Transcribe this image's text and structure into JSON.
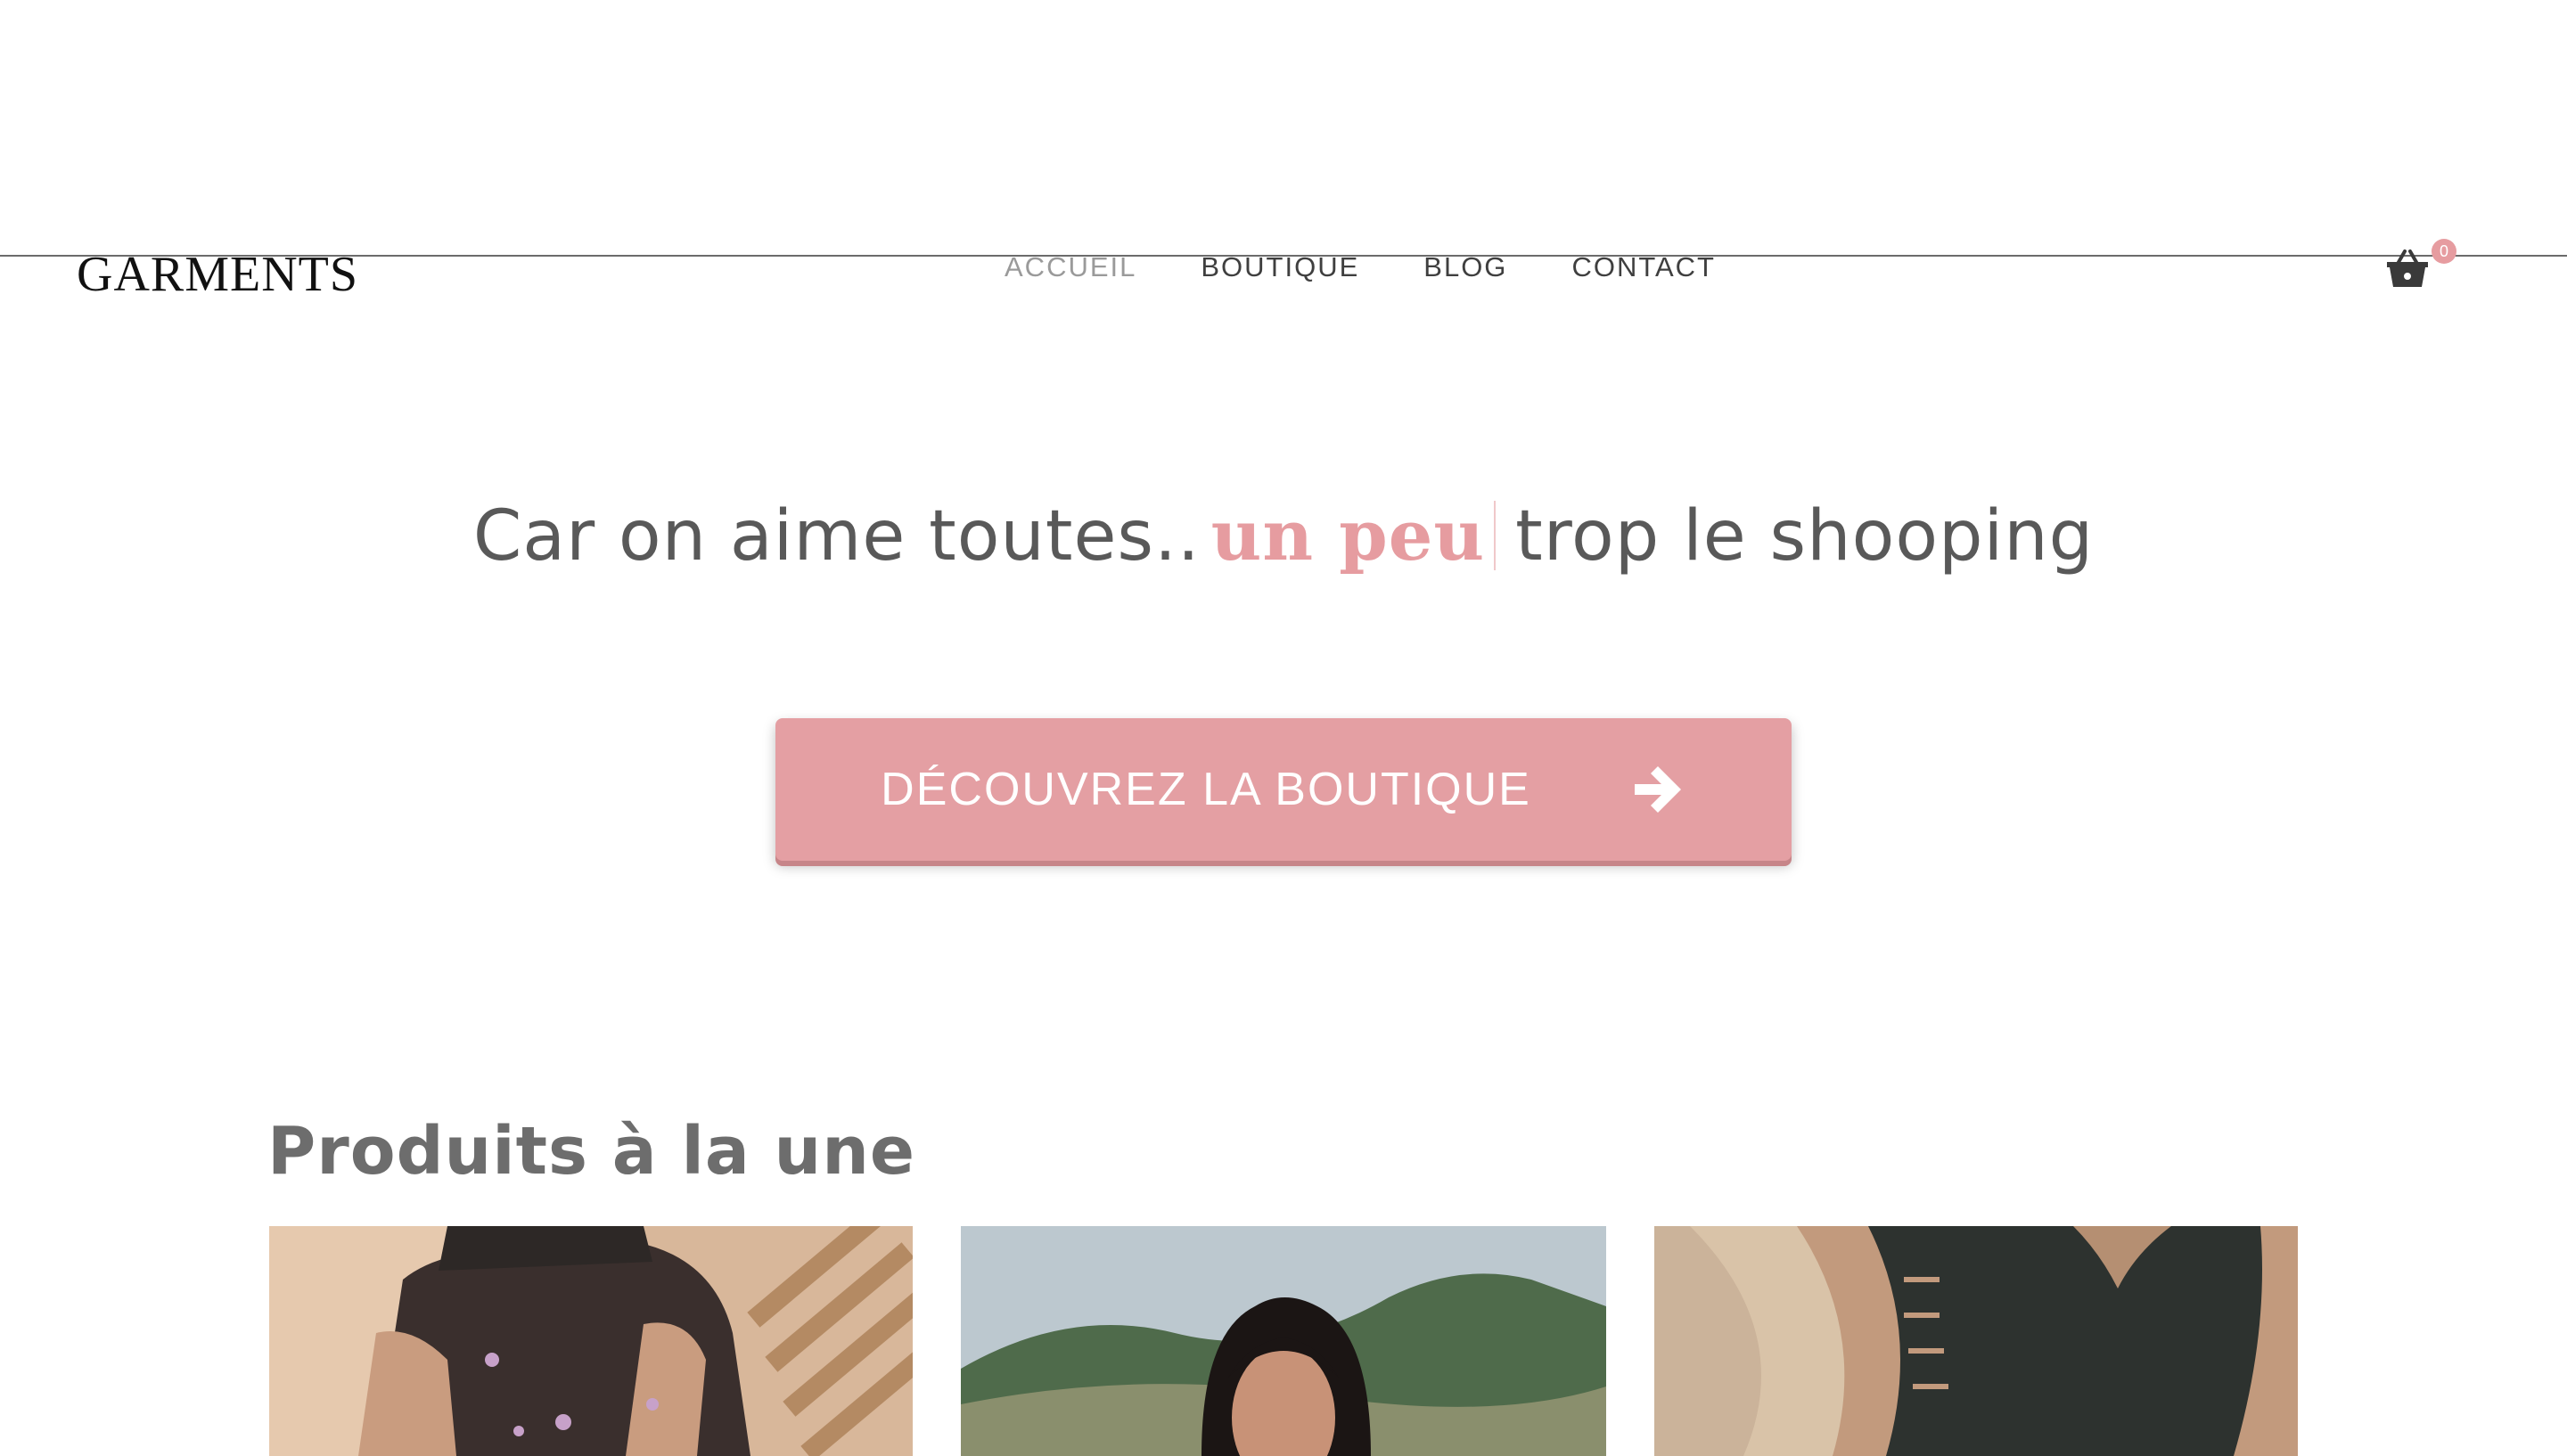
{
  "header": {
    "logo": "GARMENTS",
    "nav": [
      {
        "label": "ACCUEIL",
        "active": true
      },
      {
        "label": "BOUTIQUE",
        "active": false
      },
      {
        "label": "BLOG",
        "active": false
      },
      {
        "label": "CONTACT",
        "active": false
      }
    ],
    "cart": {
      "icon": "basket-icon",
      "count": "0"
    }
  },
  "hero": {
    "tagline_before": "Car on aime toutes..",
    "tagline_accent": "un peu",
    "tagline_after": "trop le shooping",
    "cta_label": "DÉCOUVREZ LA BOUTIQUE",
    "cta_icon": "arrow-right-icon"
  },
  "featured": {
    "title": "Produits à la une"
  },
  "colors": {
    "accent": "#e69ca0",
    "button": "#e49fa3",
    "text": "#595959"
  }
}
